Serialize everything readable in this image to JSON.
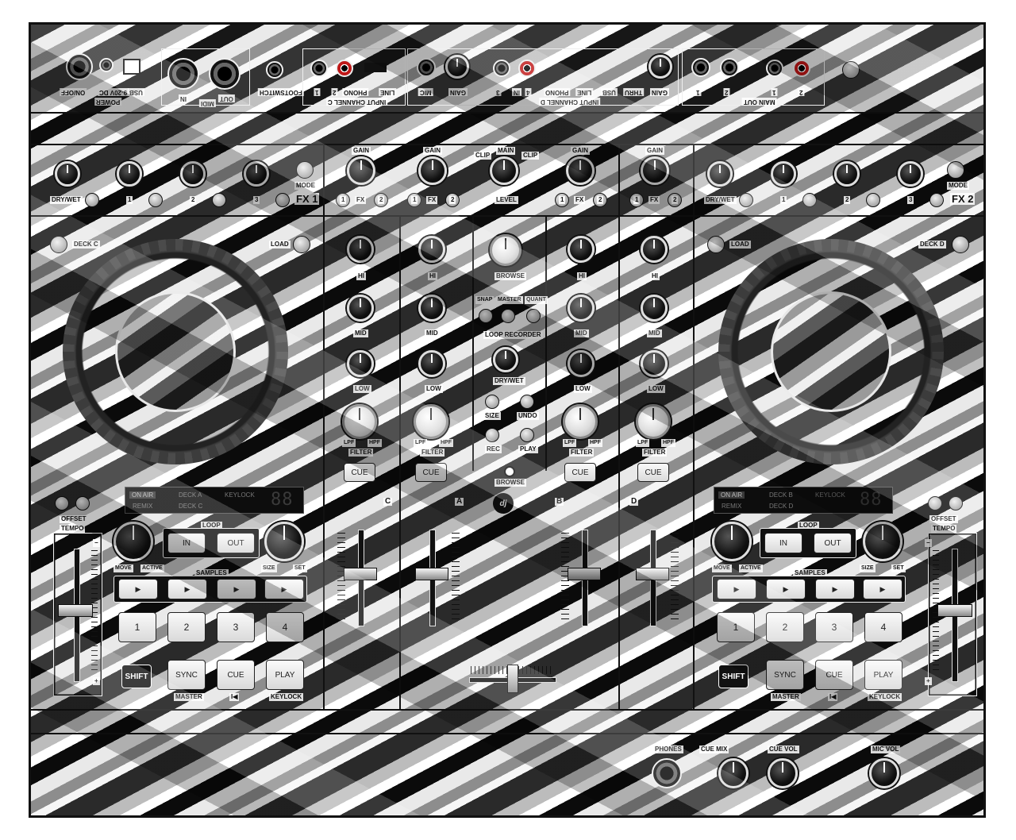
{
  "rear_panel": {
    "power": "POWER",
    "dc_in": "9-20V DC",
    "on_off": "ON/OFF",
    "usb": "USB",
    "midi": "MIDI",
    "midi_in": "IN",
    "midi_out": "OUT",
    "footswitch": "FOOTSWITCH",
    "input_c": "INPUT CHANNEL C",
    "line": "LINE",
    "phono": "PHONO",
    "input_d": "INPUT CHANNEL D",
    "mic": "MIC",
    "gain": "GAIN",
    "in": "IN",
    "thru": "THRU",
    "main_out": "MAIN OUT",
    "ch_1": "1",
    "ch_2": "2",
    "ch_3": "3",
    "ch_4": "4"
  },
  "fx1": {
    "dry_wet": "DRY/WET",
    "k1": "1",
    "k2": "2",
    "k3": "3",
    "mode": "MODE",
    "title": "FX 1"
  },
  "fx2": {
    "dry_wet": "DRY/WET",
    "k1": "1",
    "k2": "2",
    "k3": "3",
    "mode": "MODE",
    "title": "FX 2"
  },
  "mixer_top": {
    "gain": "GAIN",
    "fx": "FX",
    "fx1": "1",
    "fx2": "2",
    "main": "MAIN",
    "clip": "CLIP",
    "level": "LEVEL"
  },
  "eq": {
    "hi": "HI",
    "mid": "MID",
    "low": "LOW",
    "filter": "FILTER",
    "lpf": "LPF",
    "hpf": "HPF",
    "cue": "CUE",
    "plus": "+",
    "minus": "−"
  },
  "center": {
    "browse": "BROWSE",
    "snap": "SNAP",
    "master": "MASTER",
    "quant": "QUANT",
    "loop_recorder": "LOOP RECORDER",
    "dry_wet": "DRY/WET",
    "size": "SIZE",
    "undo": "UNDO",
    "rec": "REC",
    "play": "PLAY",
    "browse2": "BROWSE"
  },
  "assign": {
    "c": "C",
    "a": "A",
    "b": "B",
    "d": "D"
  },
  "logo_text": "dj",
  "deck_left": {
    "deck_label": "DECK C",
    "load": "LOAD",
    "on_air": "ON AIR",
    "remix": "REMIX",
    "deck_a": "DECK A",
    "deck_c": "DECK C",
    "keylock": "KEYLOCK",
    "seg": "88",
    "offset": "OFFSET",
    "tempo": "TEMPO",
    "loop": "LOOP",
    "in": "IN",
    "out": "OUT",
    "move": "MOVE",
    "active": "ACTIVE",
    "size": "SIZE",
    "set": "SET",
    "samples": "SAMPLES",
    "pads": [
      "1",
      "2",
      "3",
      "4"
    ],
    "shift": "SHIFT",
    "sync": "SYNC",
    "cue": "CUE",
    "play": "PLAY",
    "master": "MASTER",
    "keylock_sub": "KEYLOCK",
    "prev": "I◀",
    "plus": "+",
    "minus": "−"
  },
  "deck_right": {
    "deck_label": "DECK D",
    "load": "LOAD",
    "on_air": "ON AIR",
    "remix": "REMIX",
    "deck_b": "DECK B",
    "deck_d": "DECK D",
    "keylock": "KEYLOCK",
    "seg": "88",
    "offset": "OFFSET",
    "tempo": "TEMPO",
    "loop": "LOOP",
    "in": "IN",
    "out": "OUT",
    "move": "MOVE",
    "active": "ACTIVE",
    "size": "SIZE",
    "set": "SET",
    "samples": "SAMPLES",
    "pads": [
      "1",
      "2",
      "3",
      "4"
    ],
    "shift": "SHIFT",
    "sync": "SYNC",
    "cue": "CUE",
    "play": "PLAY",
    "master": "MASTER",
    "keylock_sub": "KEYLOCK",
    "prev": "I◀",
    "plus": "+",
    "minus": "−"
  },
  "front": {
    "phones": "PHONES",
    "cue_mix": "CUE MIX",
    "cue_vol": "CUE VOL",
    "mic_vol": "MIC VOL"
  },
  "icons": {
    "play": "▶",
    "cross": "✕",
    "headphones": "🎧"
  }
}
